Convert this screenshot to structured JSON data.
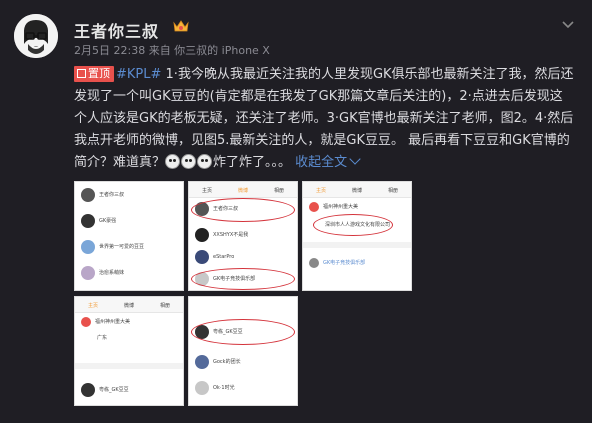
{
  "user": {
    "name": "王者你三叔",
    "meta": "2月5日 22:38 来自 你三叔的 iPhone X"
  },
  "post": {
    "pin_label": "置顶",
    "hashtag": "#KPL#",
    "body_part1": " 1·我今晚从我最近关注我的人里发现GK俱乐部也最新关注了我，然后还发现了一个叫GK豆豆的(肯定都是在我发了GK那篇文章后关注的)，2·点进去后发现这个人应该是GK的老板无疑，还关注了老师。3·GK官博也最新关注了老师，图2。4·然后我点开老师的微博，见图5.最新关注的人，就是GK豆豆。 最后再看下豆豆和GK官博的简介？难道真？",
    "body_part2": "炸了炸了。。。",
    "expand_label": "收起全文"
  },
  "thumbs": {
    "t1": {
      "rows": [
        "王者你三叔",
        "GK豪强",
        "世界第一可爱的豆豆",
        "治愈系萌妹"
      ]
    },
    "t2": {
      "tabs": [
        "主页",
        "微博",
        "相册"
      ],
      "rows": [
        "王者你三叔",
        "XXSHYX不是我",
        "eStarPro",
        "GK电子竞技俱乐部"
      ]
    },
    "t3": {
      "tabs": [
        "主页",
        "微博",
        "相册"
      ],
      "title": "福州神州重大美",
      "desc": "深圳市人人游戏文化有限公司",
      "link": "GK电子竞技俱乐部"
    },
    "t4": {
      "tabs": [
        "主页",
        "微博",
        "相册"
      ],
      "title": "福州神州重大美",
      "field": "广东",
      "rows": [
        "粤栋_GK豆豆"
      ]
    },
    "t5": {
      "rows": [
        "粤栋_GK豆豆",
        "Gock的团长",
        "Ok·1时光"
      ]
    }
  }
}
